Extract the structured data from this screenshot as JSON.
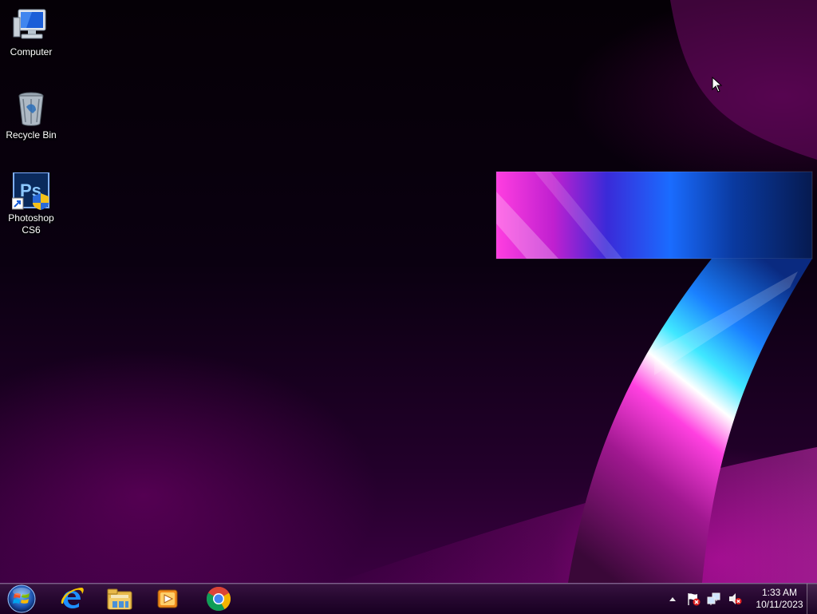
{
  "desktop": {
    "icons": [
      {
        "label": "Computer",
        "icon": "computer-icon"
      },
      {
        "label": "Recycle Bin",
        "icon": "recycle-bin-icon"
      },
      {
        "label": "Photoshop\nCS6",
        "label_line1": "Photoshop",
        "label_line2": "CS6",
        "icon": "photoshop-icon"
      }
    ],
    "wallpaper_numeral": "7"
  },
  "taskbar": {
    "start_icon": "windows-start-orb-icon",
    "pinned": [
      {
        "name": "Internet Explorer",
        "icon": "internet-explorer-icon"
      },
      {
        "name": "Windows Explorer",
        "icon": "file-explorer-icon"
      },
      {
        "name": "Windows Media Player",
        "icon": "media-player-icon"
      },
      {
        "name": "Google Chrome",
        "icon": "chrome-icon"
      }
    ],
    "tray": {
      "icons": [
        "show-hidden-icons-arrow",
        "action-center-flag-icon",
        "network-icon",
        "volume-muted-icon"
      ],
      "time": "1:33 AM",
      "date": "10/11/2023"
    }
  },
  "colors": {
    "accent_magenta": "#e020d0",
    "accent_blue": "#2060ff",
    "accent_cyan": "#30e0ff",
    "taskbar_bg": "#2a0834"
  }
}
